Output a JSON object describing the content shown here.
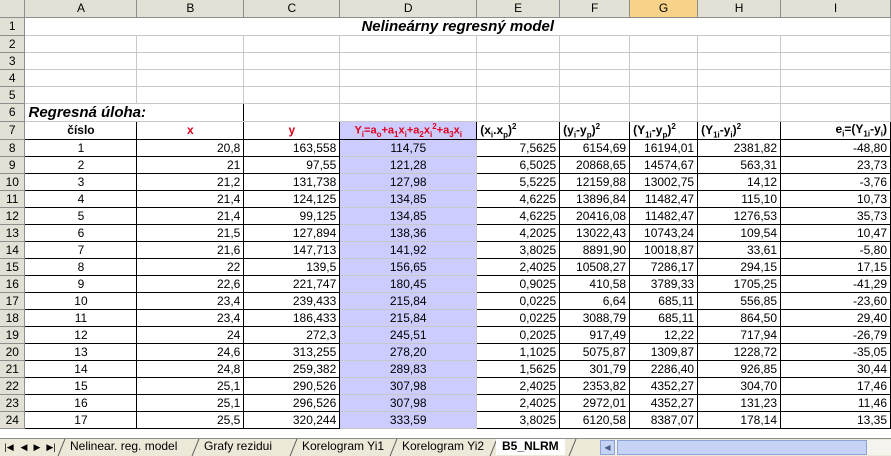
{
  "columns": [
    "A",
    "B",
    "C",
    "D",
    "E",
    "F",
    "G",
    "H",
    "I"
  ],
  "selected_column": "G",
  "title": "Nelineárny regresný model",
  "subtitle": "Regresná úloha:",
  "headers": {
    "A": "číslo",
    "B": "x",
    "C": "y",
    "D_parts": [
      "Y",
      "i",
      "=a",
      "o",
      "+a",
      "1",
      "x",
      "i",
      "+a",
      "2",
      "x",
      "i",
      "2",
      "+a",
      "3",
      "x",
      "i"
    ],
    "E_parts": [
      "(x",
      "i",
      ".x",
      "p",
      ")",
      "2"
    ],
    "F_parts": [
      "(y",
      "i",
      "-y",
      "p",
      ")",
      "2"
    ],
    "G_parts": [
      "(Y",
      "1i",
      "-y",
      "p",
      ")",
      "2"
    ],
    "H_parts": [
      "(Y",
      "1i",
      "-y",
      "i",
      ")",
      "2"
    ],
    "I_parts": [
      "e",
      "i",
      "=(Y",
      "1i",
      "-y",
      "i",
      ")"
    ]
  },
  "rows": [
    [
      "1",
      "20,8",
      "163,558",
      "114,75",
      "7,5625",
      "6154,69",
      "16194,01",
      "2381,82",
      "-48,80"
    ],
    [
      "2",
      "21",
      "97,55",
      "121,28",
      "6,5025",
      "20868,65",
      "14574,67",
      "563,31",
      "23,73"
    ],
    [
      "3",
      "21,2",
      "131,738",
      "127,98",
      "5,5225",
      "12159,88",
      "13002,75",
      "14,12",
      "-3,76"
    ],
    [
      "4",
      "21,4",
      "124,125",
      "134,85",
      "4,6225",
      "13896,84",
      "11482,47",
      "115,10",
      "10,73"
    ],
    [
      "5",
      "21,4",
      "99,125",
      "134,85",
      "4,6225",
      "20416,08",
      "11482,47",
      "1276,53",
      "35,73"
    ],
    [
      "6",
      "21,5",
      "127,894",
      "138,36",
      "4,2025",
      "13022,43",
      "10743,24",
      "109,54",
      "10,47"
    ],
    [
      "7",
      "21,6",
      "147,713",
      "141,92",
      "3,8025",
      "8891,90",
      "10018,87",
      "33,61",
      "-5,80"
    ],
    [
      "8",
      "22",
      "139,5",
      "156,65",
      "2,4025",
      "10508,27",
      "7286,17",
      "294,15",
      "17,15"
    ],
    [
      "9",
      "22,6",
      "221,747",
      "180,45",
      "0,9025",
      "410,58",
      "3789,33",
      "1705,25",
      "-41,29"
    ],
    [
      "10",
      "23,4",
      "239,433",
      "215,84",
      "0,0225",
      "6,64",
      "685,11",
      "556,85",
      "-23,60"
    ],
    [
      "11",
      "23,4",
      "186,433",
      "215,84",
      "0,0225",
      "3088,79",
      "685,11",
      "864,50",
      "29,40"
    ],
    [
      "12",
      "24",
      "272,3",
      "245,51",
      "0,2025",
      "917,49",
      "12,22",
      "717,94",
      "-26,79"
    ],
    [
      "13",
      "24,6",
      "313,255",
      "278,20",
      "1,1025",
      "5075,87",
      "1309,87",
      "1228,72",
      "-35,05"
    ],
    [
      "14",
      "24,8",
      "259,382",
      "289,83",
      "1,5625",
      "301,79",
      "2286,40",
      "926,85",
      "30,44"
    ],
    [
      "15",
      "25,1",
      "290,526",
      "307,98",
      "2,4025",
      "2353,82",
      "4352,27",
      "304,70",
      "17,46"
    ],
    [
      "16",
      "25,1",
      "296,526",
      "307,98",
      "2,4025",
      "2972,01",
      "4352,27",
      "131,23",
      "11,46"
    ],
    [
      "17",
      "25,5",
      "320,244",
      "333,59",
      "3,8025",
      "6120,58",
      "8387,07",
      "178,14",
      "13,35"
    ]
  ],
  "row_numbers": [
    "1",
    "2",
    "3",
    "4",
    "5",
    "6",
    "7",
    "8",
    "9",
    "10",
    "11",
    "12",
    "13",
    "14",
    "15",
    "16",
    "17",
    "18",
    "19",
    "20",
    "21",
    "22",
    "23",
    "24"
  ],
  "tabs": [
    {
      "label": "Nelinear. reg. model",
      "active": false
    },
    {
      "label": "Grafy rezidui",
      "active": false
    },
    {
      "label": "Korelogram Yi1",
      "active": false
    },
    {
      "label": "Korelogram Yi2",
      "active": false
    },
    {
      "label": "B5_NLRM",
      "active": true
    }
  ],
  "nav_buttons": [
    "first-sheet",
    "prev-sheet",
    "next-sheet",
    "last-sheet"
  ],
  "colors": {
    "shade": "#ccccff",
    "red": "#e0001b",
    "selected_header": "#f9d38a",
    "header_bg": "#e3e1d6"
  }
}
